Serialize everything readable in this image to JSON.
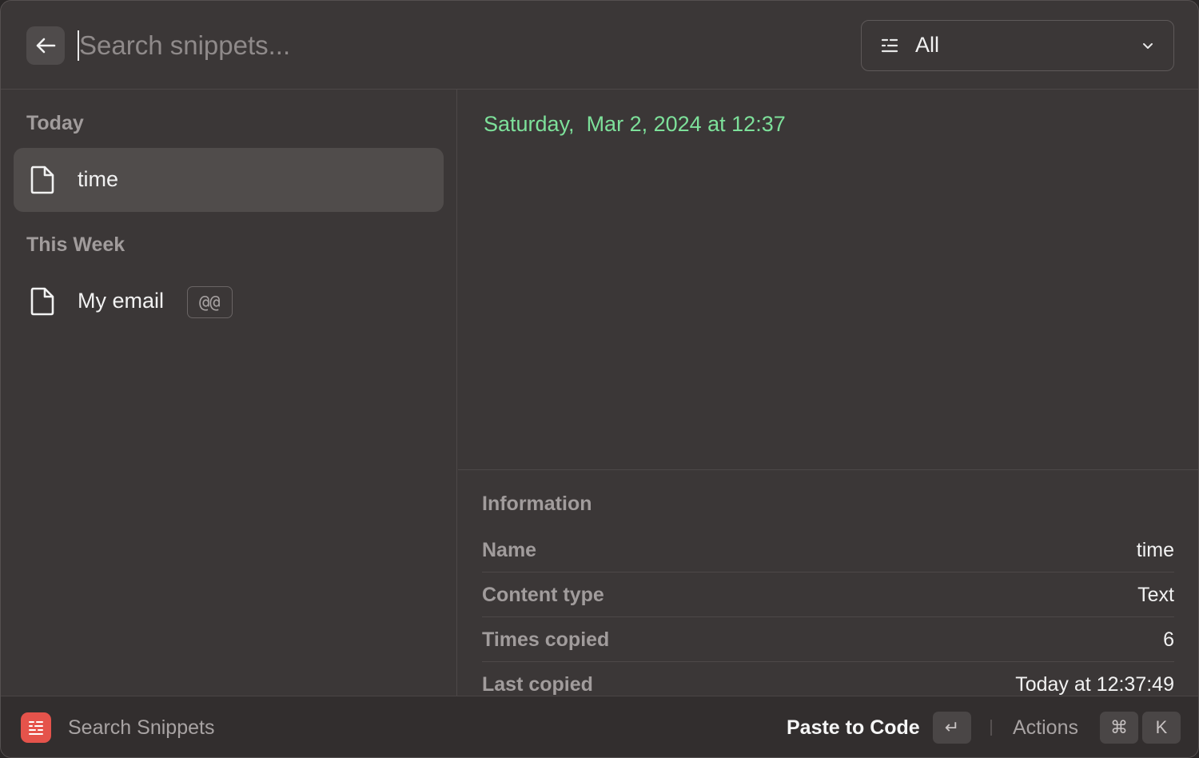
{
  "search": {
    "placeholder": "Search snippets..."
  },
  "filter": {
    "label": "All"
  },
  "list": {
    "sections": [
      {
        "title": "Today",
        "items": [
          {
            "label": "time",
            "selected": true
          }
        ]
      },
      {
        "title": "This Week",
        "items": [
          {
            "label": "My email",
            "keyword": "@@"
          }
        ]
      }
    ]
  },
  "preview": {
    "text": "Saturday,  Mar 2, 2024 at 12:37"
  },
  "info": {
    "title": "Information",
    "rows": [
      {
        "key": "Name",
        "value": "time"
      },
      {
        "key": "Content type",
        "value": "Text"
      },
      {
        "key": "Times copied",
        "value": "6"
      },
      {
        "key": "Last copied",
        "value": "Today at 12:37:49"
      }
    ]
  },
  "footer": {
    "title": "Search Snippets",
    "primary_action": "Paste to Code",
    "enter_key": "↵",
    "actions_label": "Actions",
    "cmd_key": "⌘",
    "k_key": "K"
  },
  "colors": {
    "accent_green": "#7de09a",
    "app_icon": "#e5534b"
  }
}
